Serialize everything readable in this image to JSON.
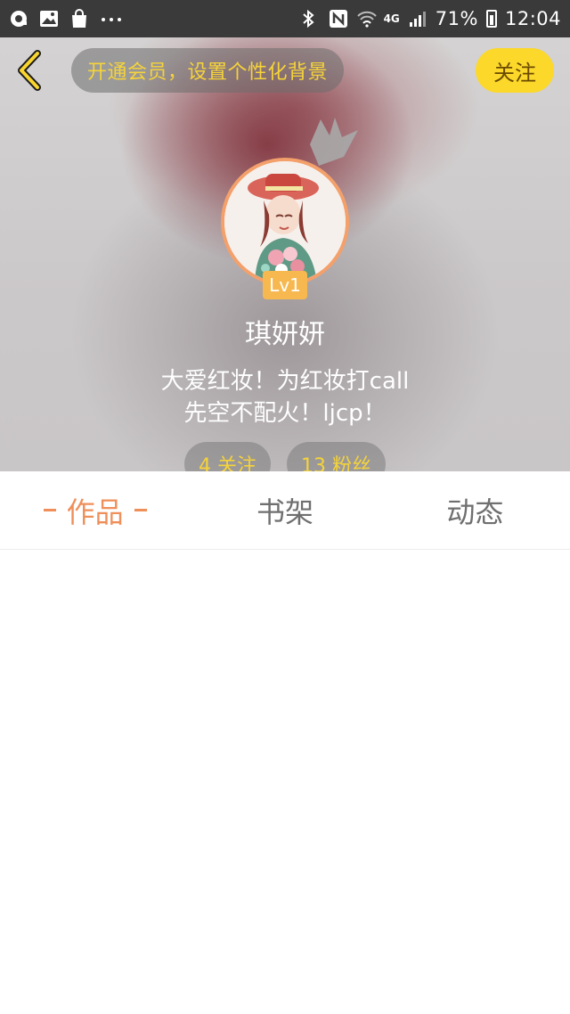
{
  "status_bar": {
    "icons_left": [
      "chat-icon",
      "gallery-icon",
      "bag-icon",
      "more-dots-icon"
    ],
    "icons_right": [
      "bluetooth-icon",
      "nfc-icon",
      "wifi-icon",
      "network-4g-icon",
      "signal-icon",
      "battery-icon"
    ],
    "network_label": "4G",
    "battery": "71%",
    "time": "12:04"
  },
  "header": {
    "back_icon": "chevron-left-icon",
    "vip_banner": "开通会员，设置个性化背景",
    "follow_label": "关注",
    "colors": {
      "accent_yellow": "#fbd82a",
      "pill_text": "#f5d33a"
    }
  },
  "profile": {
    "level": "Lv1",
    "name": "琪妍妍",
    "bio_line1": "大爱红妆！为红妆打call",
    "bio_line2": "先空不配火！ljcp！",
    "following": "4 关注",
    "fans": "13 粉丝"
  },
  "tabs": {
    "items": [
      {
        "label": "作品",
        "active": true
      },
      {
        "label": "书架",
        "active": false
      },
      {
        "label": "动态",
        "active": false
      }
    ],
    "active_color": "#ef8f5a"
  }
}
